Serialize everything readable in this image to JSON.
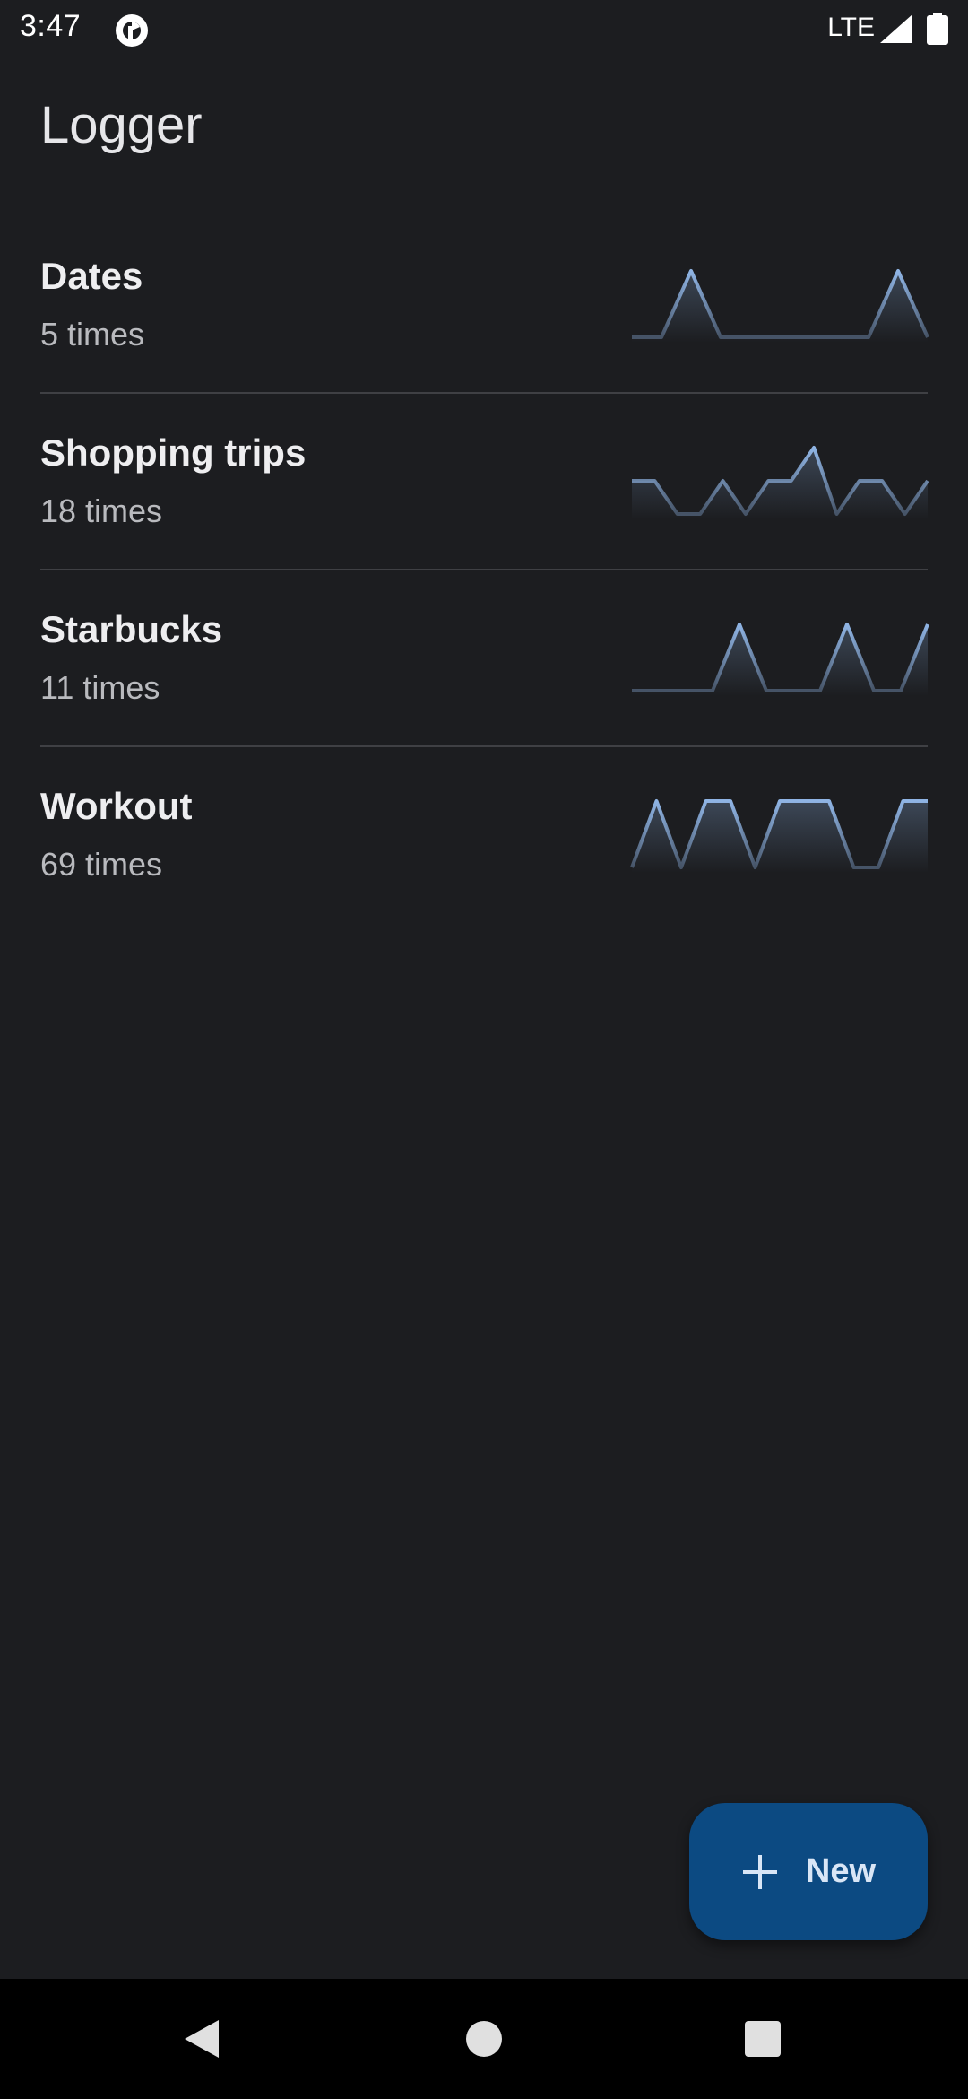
{
  "status_bar": {
    "time": "3:47",
    "network": "LTE",
    "icons": [
      "app-indicator-icon",
      "signal-icon",
      "battery-icon"
    ]
  },
  "app": {
    "title": "Logger"
  },
  "items": [
    {
      "name": "Dates",
      "count": "5 times",
      "trend": [
        0,
        0,
        1,
        0,
        0,
        0,
        0,
        0,
        0,
        1,
        0
      ]
    },
    {
      "name": "Shopping trips",
      "count": "18 times",
      "trend": [
        1,
        1,
        0,
        0,
        1,
        0,
        1,
        1,
        2,
        0,
        1,
        1,
        0,
        1
      ]
    },
    {
      "name": "Starbucks",
      "count": "11 times",
      "trend": [
        0,
        0,
        0,
        0,
        1,
        0,
        0,
        0,
        1,
        0,
        0,
        1
      ]
    },
    {
      "name": "Workout",
      "count": "69 times",
      "trend": [
        0,
        1,
        0,
        1,
        1,
        0,
        1,
        1,
        1,
        0,
        0,
        1,
        1
      ]
    }
  ],
  "fab": {
    "label": "New",
    "icon": "plus-icon"
  },
  "nav": {
    "icons": [
      "back-icon",
      "home-icon",
      "recents-icon"
    ]
  },
  "colors": {
    "background": "#1c1d20",
    "accent": "#8fb4e4",
    "fab": "#0c4a82",
    "divider": "#3f4044"
  }
}
